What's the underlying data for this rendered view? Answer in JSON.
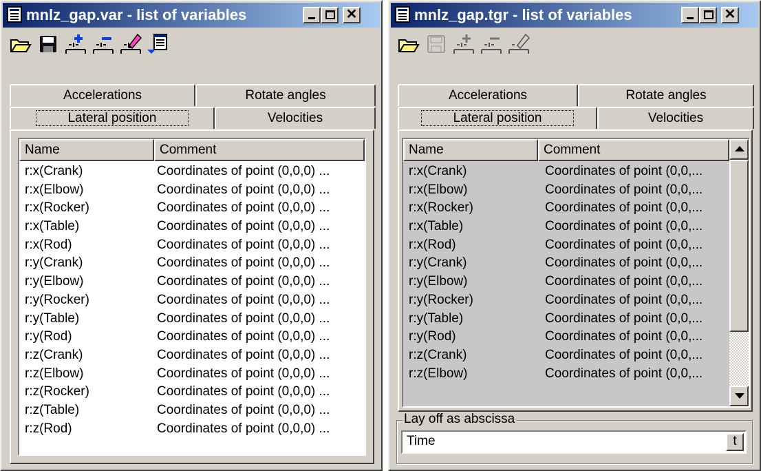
{
  "left_window": {
    "title": "mnlz_gap.var - list of variables",
    "toolbar": [
      "open-folder-icon",
      "save-icon",
      "add-variable-icon",
      "remove-variable-icon",
      "edit-variable-icon",
      "variable-list-menu-icon"
    ],
    "tabs_back": [
      "Accelerations",
      "Rotate angles"
    ],
    "tabs_front": [
      "Lateral position",
      "Velocities"
    ],
    "columns": [
      "Name",
      "Comment"
    ],
    "rows": [
      {
        "name": "r:x(Crank)",
        "comment": "Coordinates of point (0,0,0) ..."
      },
      {
        "name": "r:x(Elbow)",
        "comment": "Coordinates of point (0,0,0) ..."
      },
      {
        "name": "r:x(Rocker)",
        "comment": "Coordinates of point (0,0,0) ..."
      },
      {
        "name": "r:x(Table)",
        "comment": "Coordinates of point (0,0,0) ..."
      },
      {
        "name": "r:x(Rod)",
        "comment": "Coordinates of point (0,0,0) ..."
      },
      {
        "name": "r:y(Crank)",
        "comment": "Coordinates of point (0,0,0) ..."
      },
      {
        "name": "r:y(Elbow)",
        "comment": "Coordinates of point (0,0,0) ..."
      },
      {
        "name": "r:y(Rocker)",
        "comment": "Coordinates of point (0,0,0) ..."
      },
      {
        "name": "r:y(Table)",
        "comment": "Coordinates of point (0,0,0) ..."
      },
      {
        "name": "r:y(Rod)",
        "comment": "Coordinates of point (0,0,0) ..."
      },
      {
        "name": "r:z(Crank)",
        "comment": "Coordinates of point (0,0,0) ..."
      },
      {
        "name": "r:z(Elbow)",
        "comment": "Coordinates of point (0,0,0) ..."
      },
      {
        "name": "r:z(Rocker)",
        "comment": "Coordinates of point (0,0,0) ..."
      },
      {
        "name": "r:z(Table)",
        "comment": "Coordinates of point (0,0,0) ..."
      },
      {
        "name": "r:z(Rod)",
        "comment": "Coordinates of point (0,0,0) ..."
      }
    ]
  },
  "right_window": {
    "title": "mnlz_gap.tgr - list of variables",
    "toolbar": [
      "open-folder-icon",
      "save-icon",
      "add-variable-icon",
      "remove-variable-icon",
      "edit-variable-icon"
    ],
    "tabs_back": [
      "Accelerations",
      "Rotate angles"
    ],
    "tabs_front": [
      "Lateral position",
      "Velocities"
    ],
    "columns": [
      "Name",
      "Comment"
    ],
    "rows": [
      {
        "name": "r:x(Crank)",
        "comment": "Coordinates of point (0,0,..."
      },
      {
        "name": "r:x(Elbow)",
        "comment": "Coordinates of point (0,0,..."
      },
      {
        "name": "r:x(Rocker)",
        "comment": "Coordinates of point (0,0,..."
      },
      {
        "name": "r:x(Table)",
        "comment": "Coordinates of point (0,0,..."
      },
      {
        "name": "r:x(Rod)",
        "comment": "Coordinates of point (0,0,..."
      },
      {
        "name": "r:y(Crank)",
        "comment": "Coordinates of point (0,0,..."
      },
      {
        "name": "r:y(Elbow)",
        "comment": "Coordinates of point (0,0,..."
      },
      {
        "name": "r:y(Rocker)",
        "comment": "Coordinates of point (0,0,..."
      },
      {
        "name": "r:y(Table)",
        "comment": "Coordinates of point (0,0,..."
      },
      {
        "name": "r:y(Rod)",
        "comment": "Coordinates of point (0,0,..."
      },
      {
        "name": "r:z(Crank)",
        "comment": "Coordinates of point (0,0,..."
      },
      {
        "name": "r:z(Elbow)",
        "comment": "Coordinates of point (0,0,..."
      }
    ],
    "abscissa_group_label": "Lay off as abscissa",
    "abscissa_value": "Time",
    "abscissa_button": "t"
  },
  "colors": {
    "title_start": "#0a246a",
    "title_end": "#a6caf0",
    "face": "#d4d0c8",
    "list_grey": "#c8c6c6"
  }
}
